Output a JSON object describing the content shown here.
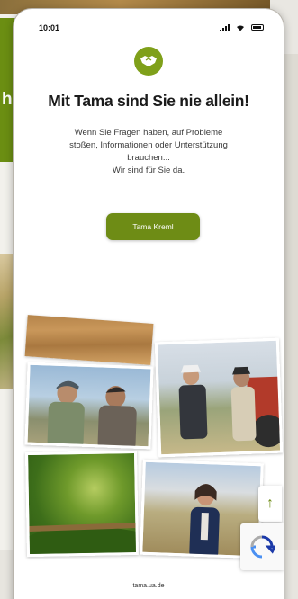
{
  "status_bar": {
    "time": "10:01"
  },
  "background_page": {
    "hero_fragment": "hi"
  },
  "header": {
    "logo_icon": "tama-handshake-icon"
  },
  "main": {
    "headline": "Mit Tama sind Sie nie allein!",
    "body_lines": [
      "Wenn Sie Fragen haben, auf Probleme",
      "stoßen, Informationen oder Unterstützung",
      "brauchen...",
      "Wir sind für Sie da."
    ],
    "cta_label": "Tama Kreml"
  },
  "colors": {
    "brand_green": "#6e8c15",
    "logo_green": "#7fa01a"
  },
  "floating": {
    "scroll_top_icon": "arrow-up-icon",
    "recaptcha_icon": "recaptcha-icon"
  },
  "footer": {
    "link_label": "tama.ua.de"
  }
}
